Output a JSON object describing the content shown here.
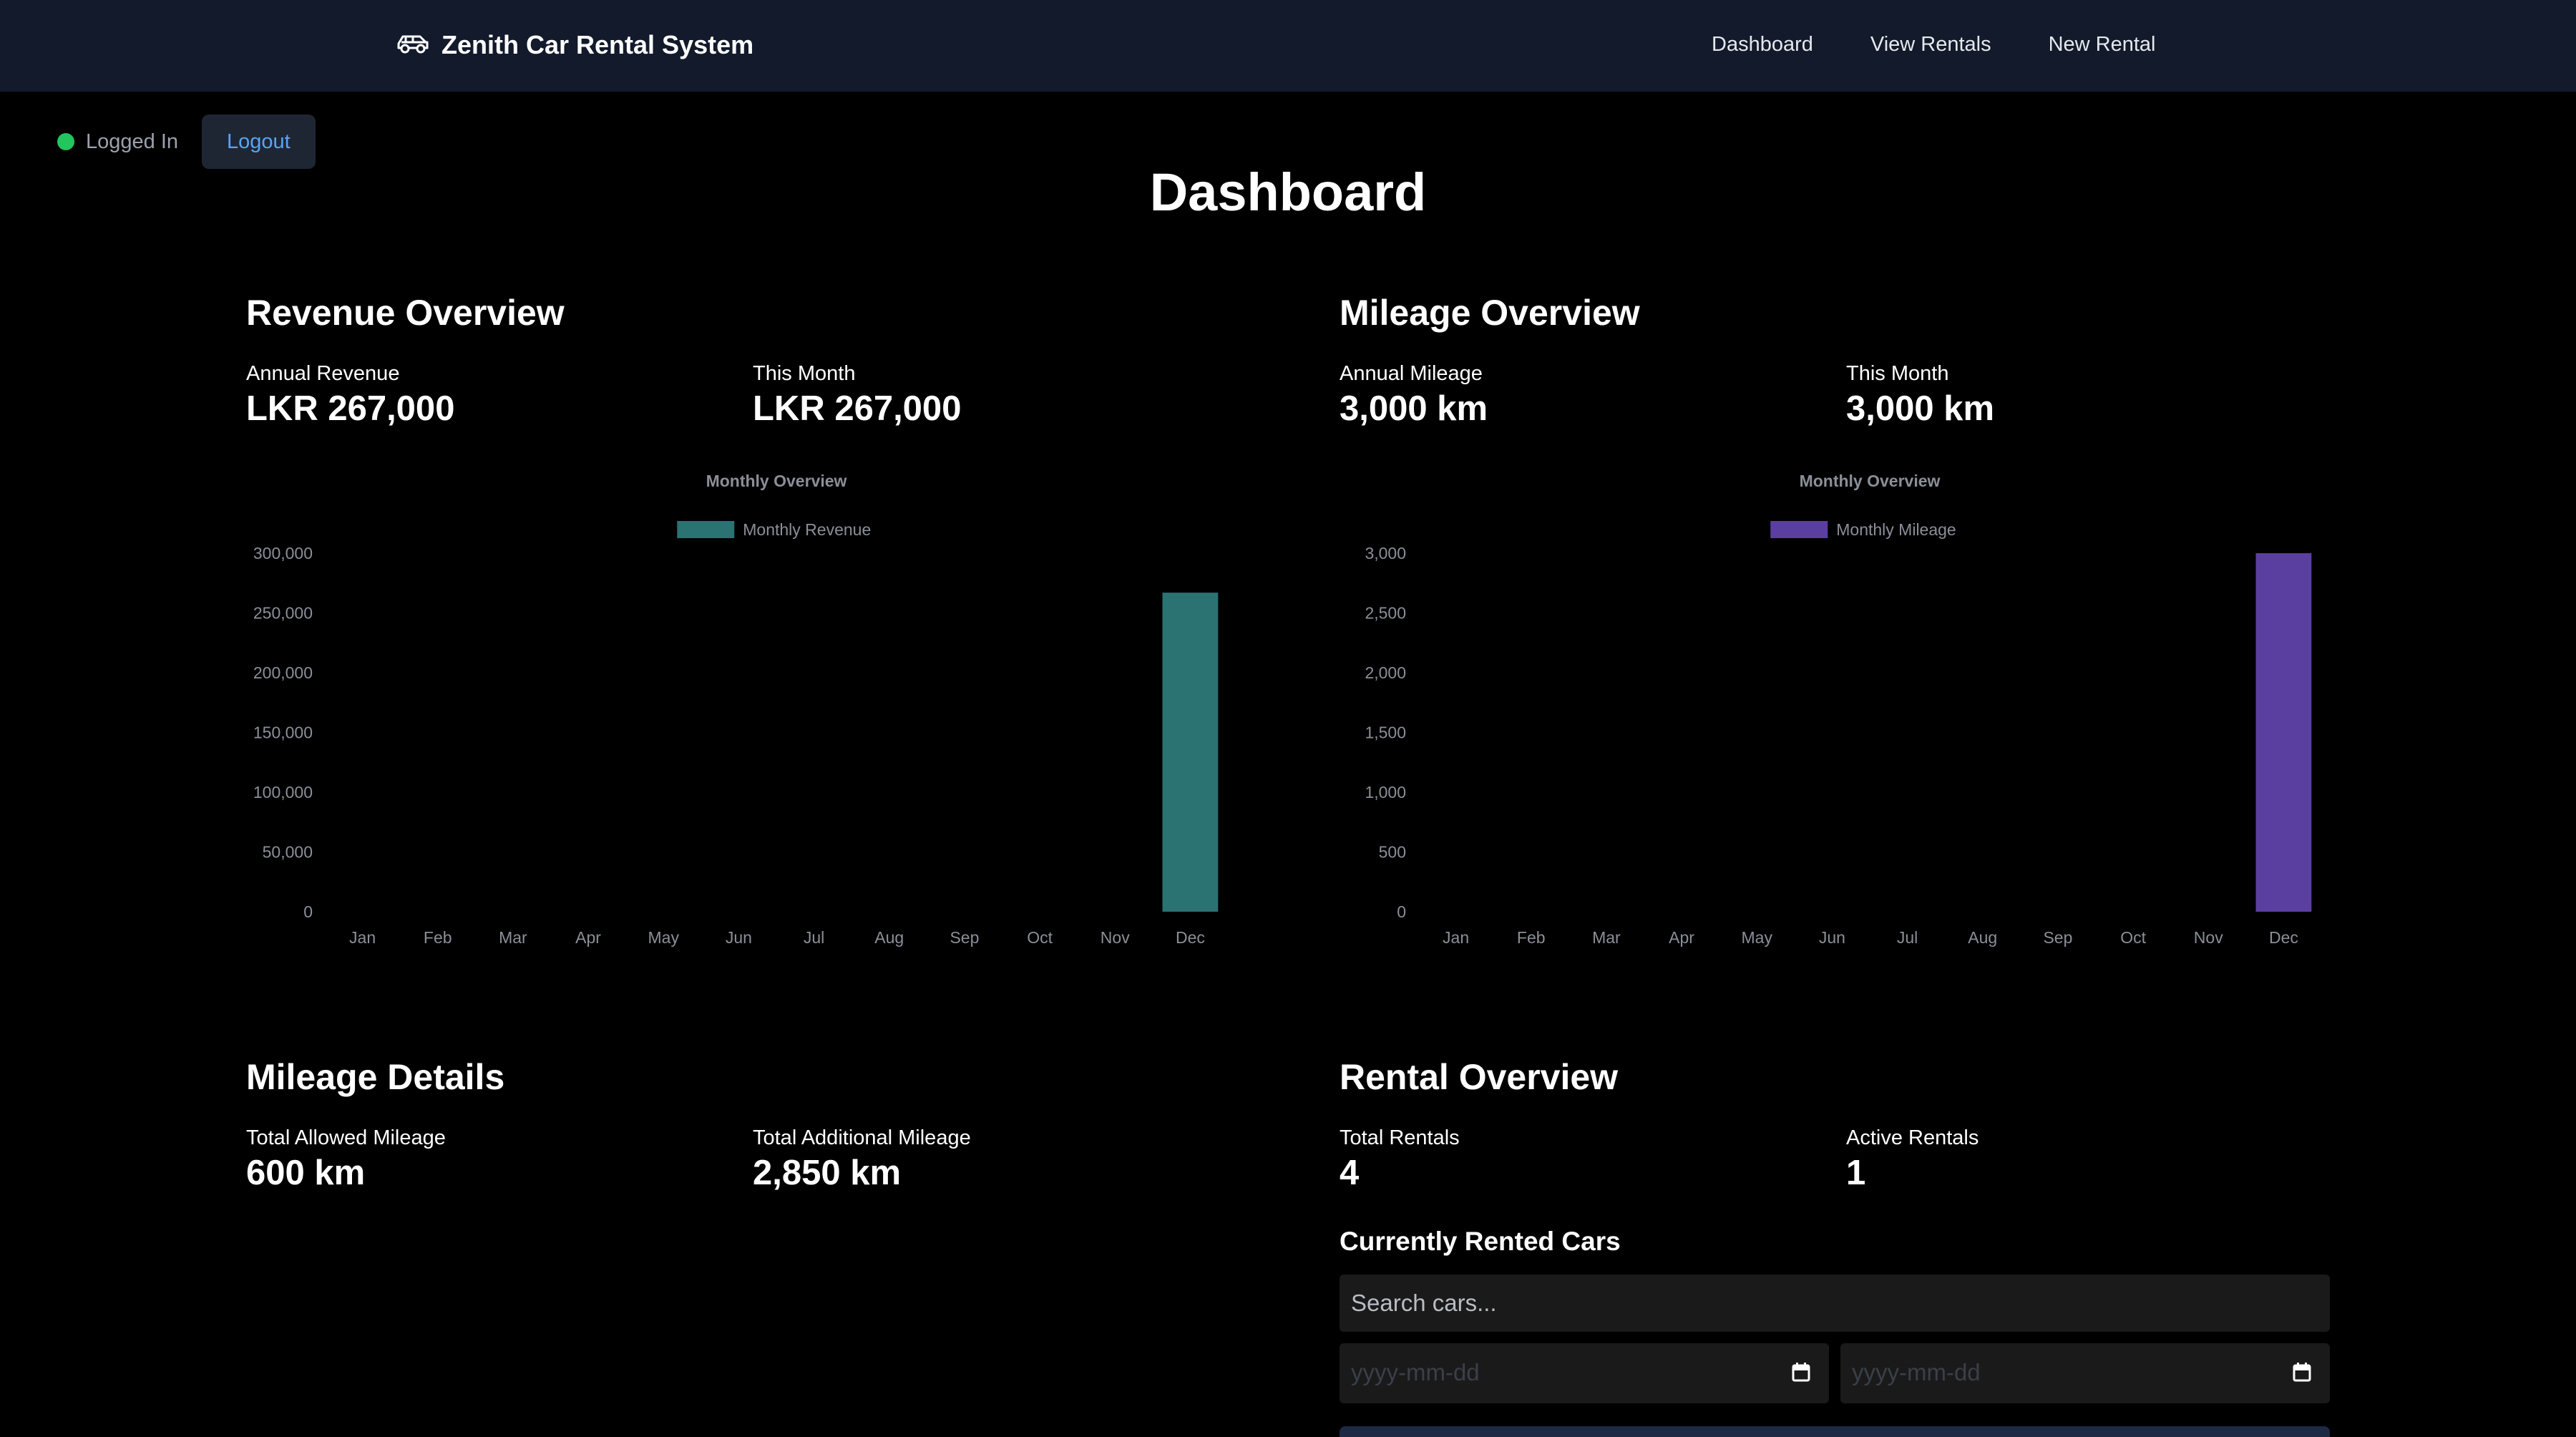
{
  "nav": {
    "brand": "Zenith Car Rental System",
    "links": [
      "Dashboard",
      "View Rentals",
      "New Rental"
    ]
  },
  "session": {
    "status": "Logged In",
    "logout": "Logout"
  },
  "page": {
    "title": "Dashboard"
  },
  "revenue": {
    "title": "Revenue Overview",
    "annual_label": "Annual Revenue",
    "annual_value": "LKR 267,000",
    "month_label": "This Month",
    "month_value": "LKR 267,000"
  },
  "mileage_overview": {
    "title": "Mileage Overview",
    "annual_label": "Annual Mileage",
    "annual_value": "3,000 km",
    "month_label": "This Month",
    "month_value": "3,000 km"
  },
  "mileage_details": {
    "title": "Mileage Details",
    "allowed_label": "Total Allowed Mileage",
    "allowed_value": "600 km",
    "additional_label": "Total Additional Mileage",
    "additional_value": "2,850 km"
  },
  "rental_overview": {
    "title": "Rental Overview",
    "total_label": "Total Rentals",
    "total_value": "4",
    "active_label": "Active Rentals",
    "active_value": "1",
    "rented_title": "Currently Rented Cars",
    "search_placeholder": "Search cars...",
    "date_placeholder": "yyyy-mm-dd"
  },
  "colors": {
    "revenue_bar": "#2b7272",
    "mileage_bar": "#5b3fa0",
    "axis_text": "#8a8f98",
    "chart_title": "#8a8f98"
  },
  "chart_data": [
    {
      "type": "bar",
      "title": "Monthly Overview",
      "categories": [
        "Jan",
        "Feb",
        "Mar",
        "Apr",
        "May",
        "Jun",
        "Jul",
        "Aug",
        "Sep",
        "Oct",
        "Nov",
        "Dec"
      ],
      "series": [
        {
          "name": "Monthly Revenue",
          "values": [
            0,
            0,
            0,
            0,
            0,
            0,
            0,
            0,
            0,
            0,
            0,
            267000
          ],
          "color": "#2b7272"
        }
      ],
      "yticks": [
        "0",
        "50,000",
        "100,000",
        "150,000",
        "200,000",
        "250,000",
        "300,000"
      ],
      "ylim": [
        0,
        300000
      ],
      "legend": "top"
    },
    {
      "type": "bar",
      "title": "Monthly Overview",
      "categories": [
        "Jan",
        "Feb",
        "Mar",
        "Apr",
        "May",
        "Jun",
        "Jul",
        "Aug",
        "Sep",
        "Oct",
        "Nov",
        "Dec"
      ],
      "series": [
        {
          "name": "Monthly Mileage",
          "values": [
            0,
            0,
            0,
            0,
            0,
            0,
            0,
            0,
            0,
            0,
            0,
            3000
          ],
          "color": "#5b3fa0"
        }
      ],
      "yticks": [
        "0",
        "500",
        "1,000",
        "1,500",
        "2,000",
        "2,500",
        "3,000"
      ],
      "ylim": [
        0,
        3000
      ],
      "legend": "top"
    }
  ]
}
